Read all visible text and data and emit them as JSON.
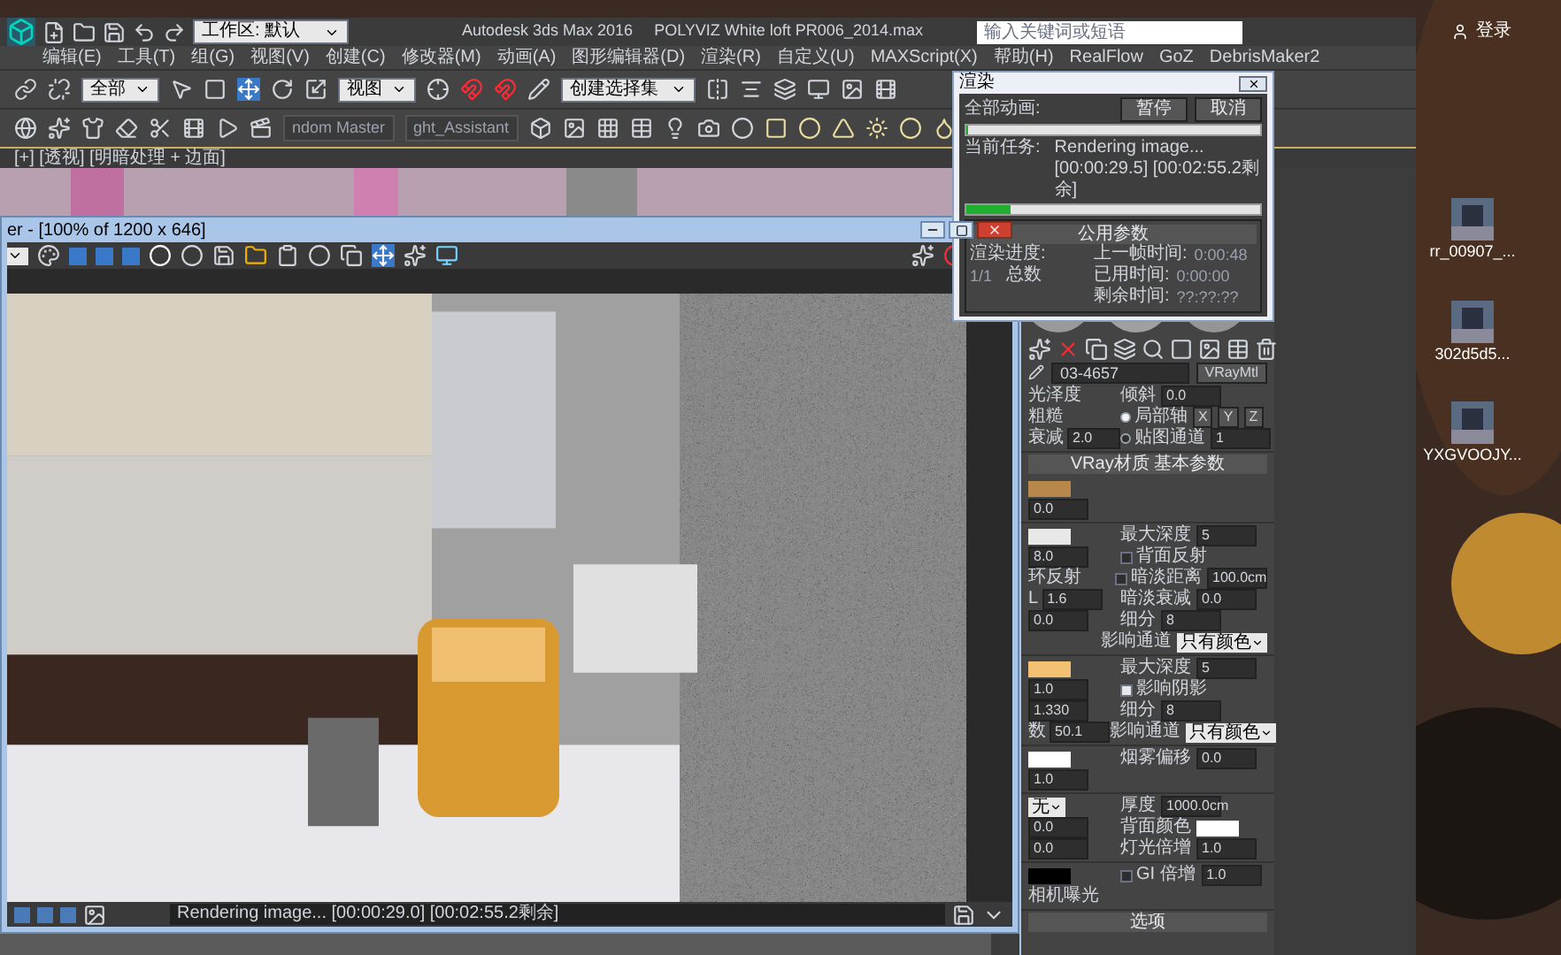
{
  "desktop": {
    "search": {
      "placeholder": "输入关键词或短语"
    },
    "login": "登录",
    "icons": [
      {
        "label": "rr_00907_..."
      },
      {
        "label": "302d5d5..."
      },
      {
        "label": "YXGVOOJY..."
      }
    ]
  },
  "max_window": {
    "workspace": "工作区: 默认",
    "title": "Autodesk 3ds Max 2016",
    "file": "POLYVIZ White loft PR006_2014.max",
    "menu": [
      "编辑(E)",
      "工具(T)",
      "组(G)",
      "视图(V)",
      "创建(C)",
      "修改器(M)",
      "动画(A)",
      "图形编辑器(D)",
      "渲染(R)",
      "自定义(U)",
      "MAXScript(X)",
      "帮助(H)",
      "RealFlow",
      "GoZ",
      "DebrisMaker2"
    ],
    "selection_filter": "全部",
    "reference_coords": "视图",
    "selection_set": "创建选择集",
    "tabs": [
      "ndom Master",
      "ght_Assistant"
    ],
    "viewport_label": "[+] [透视] [明暗处理 + 边面]"
  },
  "frame_buffer": {
    "title": "er - [100% of 1200 x 646]",
    "status": "Rendering image... [00:00:29.0] [00:02:55.2剩余]"
  },
  "render_dialog": {
    "title": "渲染",
    "all_label": "全部动画:",
    "all_progress": {
      "level": 0
    },
    "buttons": [
      "暂停",
      "取消"
    ],
    "task_label": "当前任务:",
    "task": "Rendering image... [00:00:29.5] [00:02:55.2剩余]",
    "task_progress": {
      "level": 0.15
    },
    "section": "公用参数",
    "progress_label": "渲染进度:",
    "frame": "1/1",
    "total": "总数",
    "times": [
      {
        "label": "上一帧时间:",
        "value": "0:00:48"
      },
      {
        "label": "已用时间:",
        "value": "0:00:00"
      },
      {
        "label": "剩余时间:",
        "value": "??:??:??"
      }
    ]
  },
  "material_editor": {
    "name": "03-4657",
    "type": "VRayMtl",
    "header": "VRay材质 基本参数",
    "footer": "选项",
    "groups": [
      [
        {
          "left": [
            {
              "kind": "label",
              "text": "光泽度"
            }
          ],
          "right": [
            {
              "kind": "label",
              "text": "倾斜"
            },
            {
              "kind": "spinner",
              "text": "0.0"
            }
          ]
        },
        {
          "left": [
            {
              "kind": "label",
              "text": "粗糙"
            }
          ],
          "right": [
            {
              "kind": "radio",
              "text": "局部轴",
              "selected": true
            },
            {
              "kind": "button",
              "text": "X"
            },
            {
              "kind": "button",
              "text": "Y"
            },
            {
              "kind": "button",
              "text": "Z"
            }
          ]
        },
        {
          "left": [
            {
              "kind": "label",
              "text": "衰减"
            },
            {
              "kind": "spinner",
              "text": "2.0"
            }
          ],
          "right": [
            {
              "kind": "radio",
              "text": "贴图通道",
              "selected": false
            },
            {
              "kind": "spinner",
              "text": "1"
            }
          ]
        }
      ],
      [
        {
          "left": [
            {
              "kind": "swatch",
              "color": "#b8884a"
            }
          ]
        },
        {
          "left": [
            {
              "kind": "spinner",
              "text": "0.0"
            }
          ]
        }
      ],
      [
        {
          "left": [
            {
              "kind": "swatch",
              "color": "#e8e8e8"
            }
          ],
          "right": [
            {
              "kind": "label",
              "text": "最大深度"
            },
            {
              "kind": "spinner",
              "text": "5"
            }
          ]
        },
        {
          "left": [
            {
              "kind": "spinner",
              "text": "8.0"
            }
          ],
          "right": [
            {
              "kind": "check",
              "text": "背面反射",
              "checked": false
            }
          ]
        },
        {
          "left": [
            {
              "kind": "label",
              "text": "环反射"
            }
          ],
          "right": [
            {
              "kind": "check",
              "text": "暗淡距离",
              "checked": false
            },
            {
              "kind": "spinner",
              "text": "100.0cm"
            }
          ]
        },
        {
          "left": [
            {
              "kind": "label",
              "text": "L"
            },
            {
              "kind": "spinner",
              "text": "1.6"
            }
          ],
          "right": [
            {
              "kind": "label",
              "text": "暗淡衰减"
            },
            {
              "kind": "spinner",
              "text": "0.0"
            }
          ]
        },
        {
          "left": [
            {
              "kind": "spinner",
              "text": "0.0"
            }
          ],
          "right": [
            {
              "kind": "label",
              "text": "细分"
            },
            {
              "kind": "spinner",
              "text": "8"
            }
          ]
        },
        {
          "right": [
            {
              "kind": "label",
              "text": "影响通道"
            },
            {
              "kind": "dropdown",
              "text": "只有颜色"
            }
          ]
        }
      ],
      [
        {
          "left": [
            {
              "kind": "swatch",
              "color": "#f2c272"
            }
          ],
          "right": [
            {
              "kind": "label",
              "text": "最大深度"
            },
            {
              "kind": "spinner",
              "text": "5"
            }
          ]
        },
        {
          "left": [
            {
              "kind": "spinner",
              "text": "1.0"
            }
          ],
          "right": [
            {
              "kind": "check",
              "text": "影响阴影",
              "checked": true
            }
          ]
        },
        {
          "left": [
            {
              "kind": "spinner",
              "text": "1.330"
            }
          ],
          "right": [
            {
              "kind": "label",
              "text": "细分"
            },
            {
              "kind": "spinner",
              "text": "8"
            }
          ]
        },
        {
          "left": [
            {
              "kind": "label",
              "text": "数"
            },
            {
              "kind": "spinner",
              "text": "50.1"
            }
          ],
          "right": [
            {
              "kind": "label",
              "text": "影响通道"
            },
            {
              "kind": "dropdown",
              "text": "只有颜色"
            }
          ]
        }
      ],
      [
        {
          "left": [
            {
              "kind": "swatch",
              "color": "#ffffff"
            }
          ],
          "right": [
            {
              "kind": "label",
              "text": "烟雾偏移"
            },
            {
              "kind": "spinner",
              "text": "0.0"
            }
          ]
        },
        {
          "left": [
            {
              "kind": "spinner",
              "text": "1.0"
            }
          ]
        }
      ],
      [
        {
          "left": [
            {
              "kind": "dropdown",
              "text": "无"
            }
          ],
          "right": [
            {
              "kind": "label",
              "text": "厚度"
            },
            {
              "kind": "spinner",
              "text": "1000.0cm"
            }
          ]
        },
        {
          "left": [
            {
              "kind": "spinner",
              "text": "0.0"
            }
          ],
          "right": [
            {
              "kind": "label",
              "text": "背面颜色"
            },
            {
              "kind": "swatch",
              "color": "#ffffff"
            }
          ]
        },
        {
          "left": [
            {
              "kind": "spinner",
              "text": "0.0"
            }
          ],
          "right": [
            {
              "kind": "label",
              "text": "灯光倍增"
            },
            {
              "kind": "spinner",
              "text": "1.0"
            }
          ]
        }
      ],
      [
        {
          "left": [
            {
              "kind": "swatch",
              "color": "#000000"
            }
          ],
          "right": [
            {
              "kind": "check",
              "text": "GI",
              "checked": false
            },
            {
              "kind": "label",
              "text": "倍增"
            },
            {
              "kind": "spinner",
              "text": "1.0"
            }
          ]
        },
        {
          "left": [
            {
              "kind": "label",
              "text": "相机曝光"
            }
          ]
        }
      ]
    ]
  }
}
